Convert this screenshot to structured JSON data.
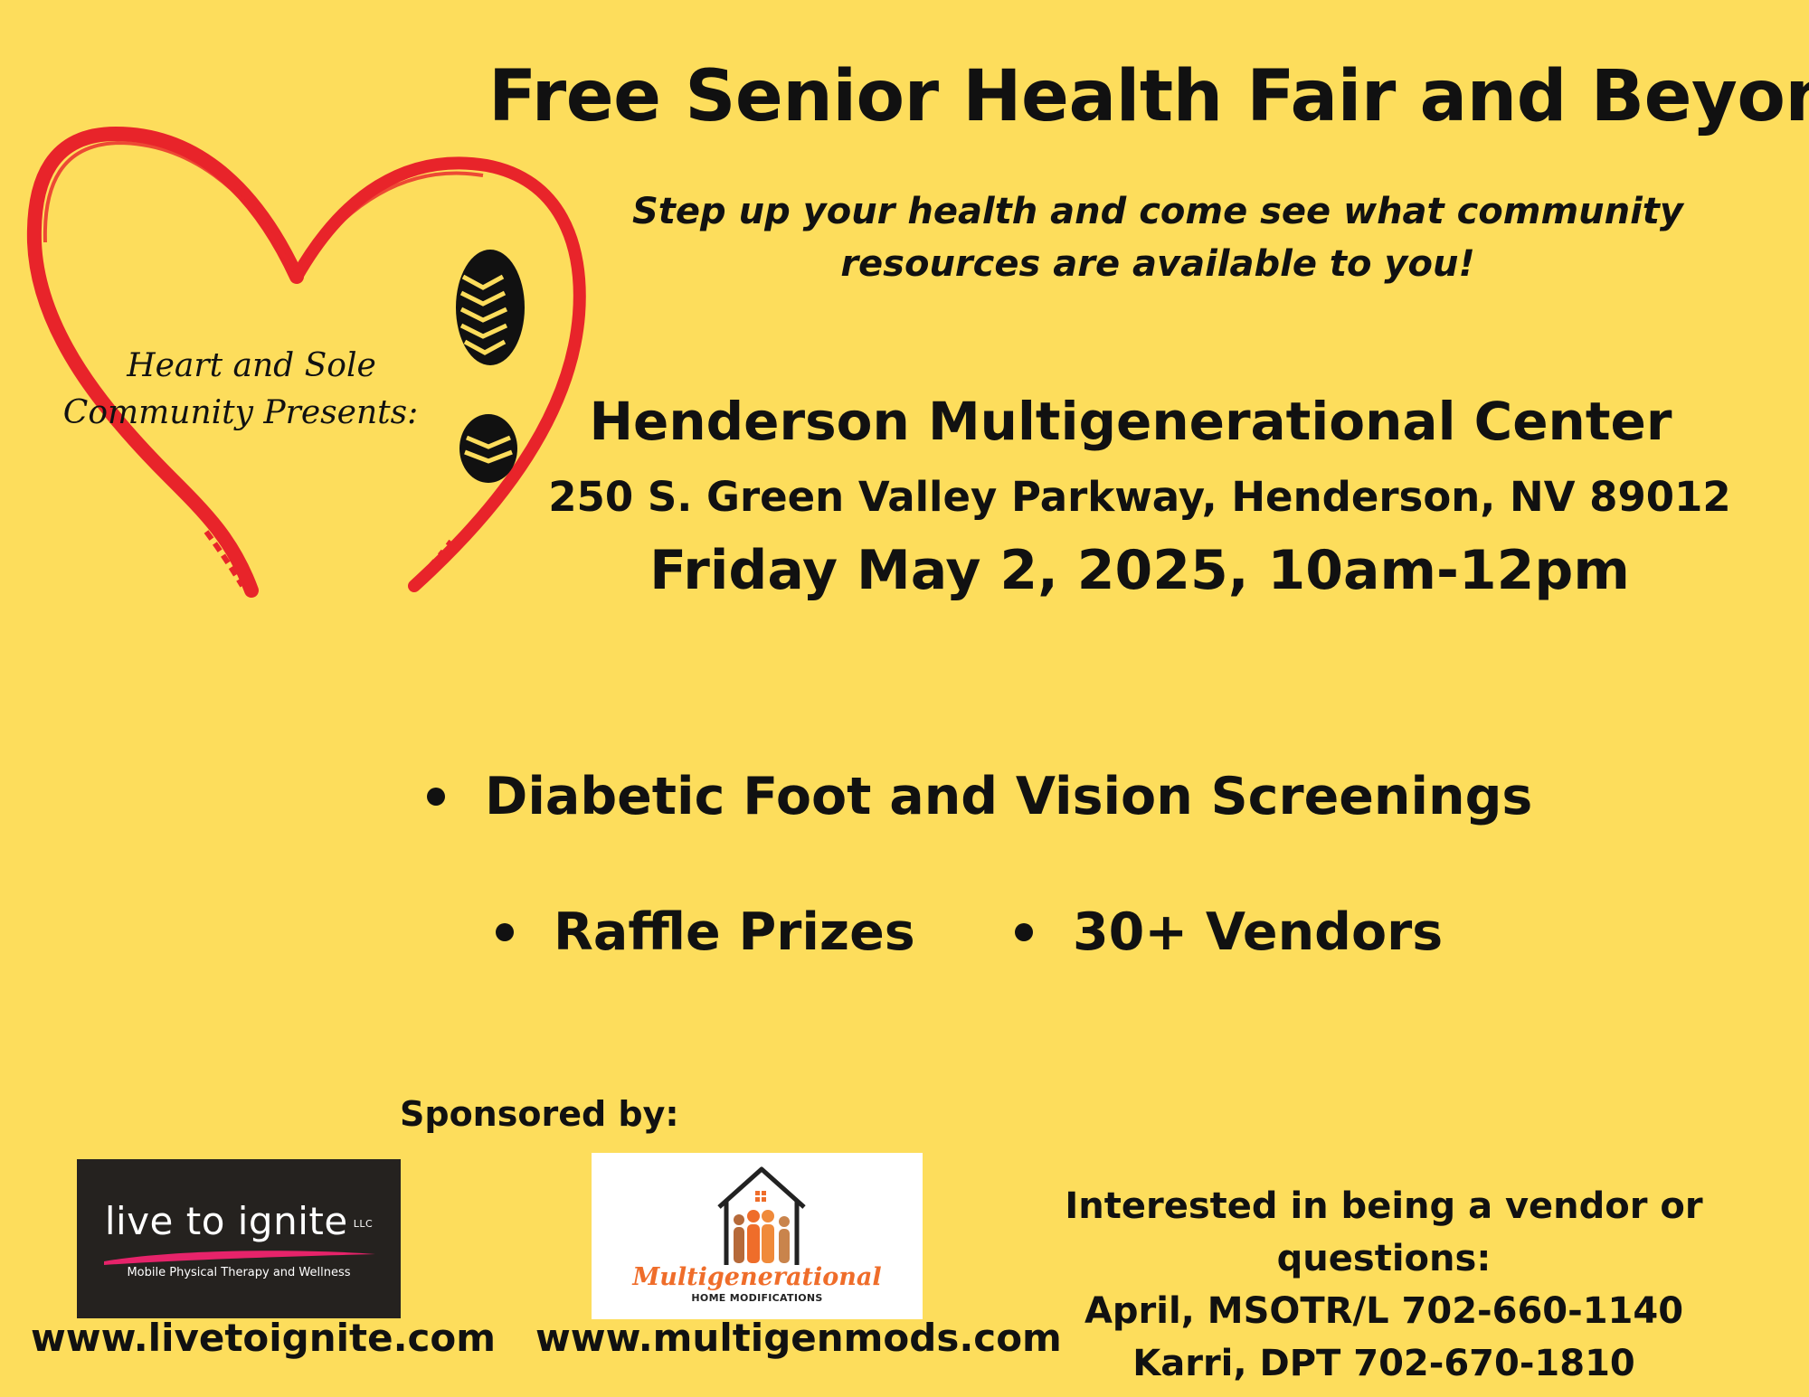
{
  "header": {
    "title": "Free Senior Health Fair and Beyond",
    "tagline_line1": "Step up your health and come see what community",
    "tagline_line2": "resources are available to you!"
  },
  "heart_logo": {
    "line1": "Heart and Sole",
    "line2": "Community Presents:",
    "heart_color": "#e8242a"
  },
  "event": {
    "venue": "Henderson Multigenerational Center",
    "address": "250 S. Green Valley Parkway, Henderson, NV 89012",
    "date_time": "Friday May 2, 2025, 10am-12pm"
  },
  "features": [
    "Diabetic Foot and Vision Screenings",
    "Raffle Prizes",
    "30+ Vendors"
  ],
  "sponsors": {
    "heading": "Sponsored by:",
    "live_to_ignite": {
      "wordmark": "live to ignite",
      "suffix": "LLC",
      "tagline": "Mobile Physical Therapy and Wellness",
      "url": "www.livetoignite.com",
      "accent_color": "#e6236a"
    },
    "multigen": {
      "wordmark": "Multigenerational",
      "sub": "HOME MODIFICATIONS",
      "url": "www.multigenmods.com",
      "accent_color": "#ef6d2a"
    }
  },
  "contact": {
    "heading": "Interested in being a vendor or questions:",
    "contact1": "April, MSOTR/L 702-660-1140",
    "contact2": "Karri, DPT 702-670-1810"
  },
  "colors": {
    "background": "#fddd5c",
    "text": "#111111"
  }
}
